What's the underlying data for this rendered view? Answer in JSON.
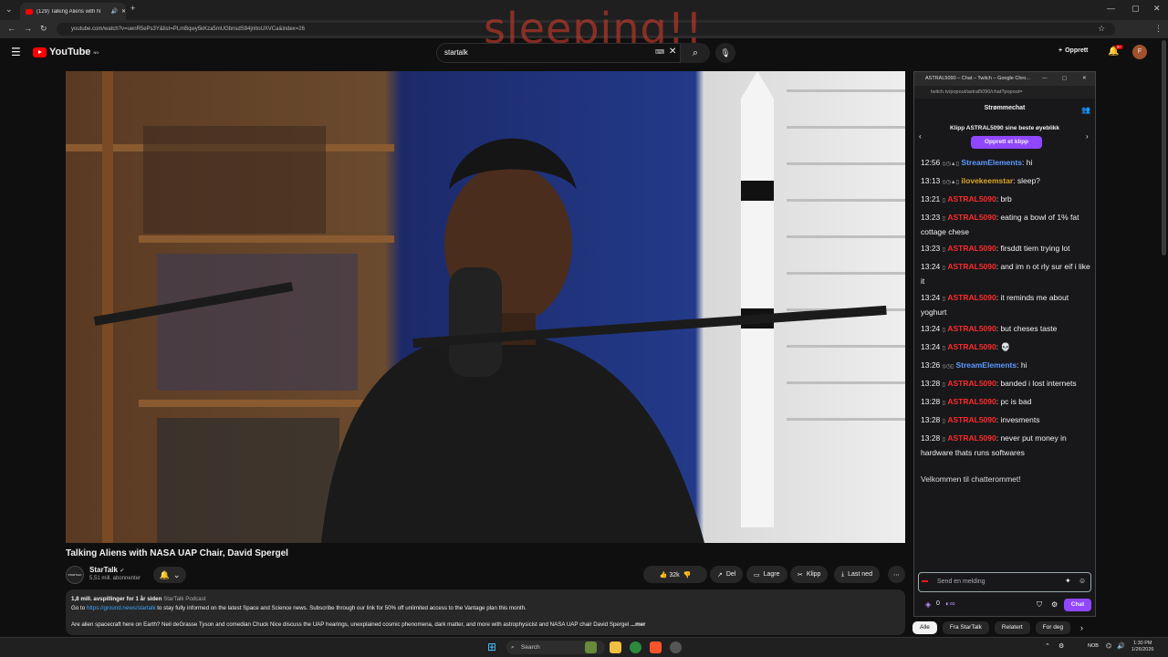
{
  "browser": {
    "tab_title": "(129) Talking Aliens with N",
    "url": "youtube.com/watch?v=uenR5ePs3Y&list=PLmBqwy5kKza5mUGbnsdS94jnltoUXVCa&index=26"
  },
  "overlay_text": "sleeping!!",
  "youtube": {
    "logo": "YouTube",
    "logo_region": "NO",
    "search_query": "startalk",
    "create_label": "Opprett",
    "notif_count": "9+",
    "avatar_letter": "F"
  },
  "video": {
    "title": "Talking Aliens with NASA UAP Chair, David Spergel",
    "channel": "StarTalk",
    "channel_avatar": "STARTALK",
    "subscribers": "5,51 mill. abonnenter",
    "likes": "32k",
    "share": "Del",
    "save": "Lagre",
    "clip": "Klipp",
    "download": "Last ned",
    "views_time": "1,8 mill. avspillinger  for 1 år siden",
    "playlist": "StarTalk Podcast",
    "desc_go": "Go to",
    "desc_link": "https://ground.news/startalk",
    "desc_rest": "to stay fully informed on the latest Space and Science news. Subscribe through our link for 50% off unlimited access to the Vantage plan this month.",
    "desc_line2": "Are alien spacecraft here on Earth? Neil deGrasse Tyson and comedian Chuck Nice discuss the UAP hearings, unexplained cosmic phenomena, dark matter, and more with astrophysicist and NASA UAP chair David Spergel",
    "more": "...mer"
  },
  "twitch": {
    "window_title": "ASTRAL5090 – Chat – Twitch – Google Chro...",
    "url": "twitch.tv/popout/astral5090/chat?popout=",
    "header": "Strømmechat",
    "clip_text": "Klipp ASTRAL5090 sine beste øyeblikk",
    "clip_button": "Opprett et klipp",
    "messages": [
      {
        "time": "12:56",
        "badges": "⦸◷▲▯",
        "user": "StreamElements",
        "color": "#5c9bff",
        "text": ": hi"
      },
      {
        "time": "13:13",
        "badges": "⦸◷▲▯",
        "user": "ilovekeemstar",
        "color": "#daa520",
        "text": ": sleep?"
      },
      {
        "time": "13:21",
        "badges": "▯",
        "user": "ASTRAL5090",
        "color": "#ff2a2a",
        "text": ": brb"
      },
      {
        "time": "13:23",
        "badges": "▯",
        "user": "ASTRAL5090",
        "color": "#ff2a2a",
        "text": ": eating a bowl of 1% fat cottage chese"
      },
      {
        "time": "13:23",
        "badges": "▯",
        "user": "ASTRAL5090",
        "color": "#ff2a2a",
        "text": ": firsddt tiem trying lot"
      },
      {
        "time": "13:24",
        "badges": "▯",
        "user": "ASTRAL5090",
        "color": "#ff2a2a",
        "text": ": and im n ot rly sur eif i like it"
      },
      {
        "time": "13:24",
        "badges": "▯",
        "user": "ASTRAL5090",
        "color": "#ff2a2a",
        "text": ": it reminds me about yoghurt"
      },
      {
        "time": "13:24",
        "badges": "▯",
        "user": "ASTRAL5090",
        "color": "#ff2a2a",
        "text": ": but cheses taste"
      },
      {
        "time": "13:24",
        "badges": "▯",
        "user": "ASTRAL5090",
        "color": "#ff2a2a",
        "text": ": 💀"
      },
      {
        "time": "13:26",
        "badges": "⦸◷▯",
        "user": "StreamElements",
        "color": "#5c9bff",
        "text": ": hi"
      },
      {
        "time": "13:28",
        "badges": "▯",
        "user": "ASTRAL5090",
        "color": "#ff2a2a",
        "text": ": banded i lost internets"
      },
      {
        "time": "13:28",
        "badges": "▯",
        "user": "ASTRAL5090",
        "color": "#ff2a2a",
        "text": ": pc is bad"
      },
      {
        "time": "13:28",
        "badges": "▯",
        "user": "ASTRAL5090",
        "color": "#ff2a2a",
        "text": ": invesments"
      },
      {
        "time": "13:28",
        "badges": "▯",
        "user": "ASTRAL5090",
        "color": "#ff2a2a",
        "text": ": never put money in hardware thats runs softwares"
      }
    ],
    "welcome": "Velkommen til chatterommet!",
    "input_placeholder": "Send en melding",
    "points": "0",
    "chat_button": "Chat"
  },
  "chips": [
    "Alle",
    "Fra StarTalk",
    "Relatert",
    "For deg"
  ],
  "taskbar": {
    "search": "Search",
    "lang": "NOB",
    "time": "1:30 PM",
    "date": "1/26/2026"
  }
}
